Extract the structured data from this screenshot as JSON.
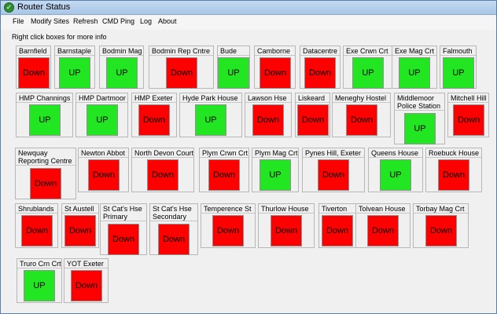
{
  "window": {
    "title": "Router Status",
    "icon": "router-status-app-icon"
  },
  "menu": [
    "File",
    "Modify Sites",
    "Refresh",
    "CMD Ping",
    "Log",
    "About"
  ],
  "hint": "Right click boxes for more info",
  "status_labels": {
    "up": "UP",
    "down": "Down"
  },
  "colors": {
    "up": "#22e622",
    "down": "#ff0000"
  },
  "sites": [
    {
      "name": "Barnfield",
      "status": "down"
    },
    {
      "name": "Barnstaple",
      "status": "up"
    },
    {
      "name": "Bodmin Mag",
      "status": "up"
    },
    {
      "name": "Bodmin Rep Cntre",
      "status": "down"
    },
    {
      "name": "Bude",
      "status": "up"
    },
    {
      "name": "Camborne",
      "status": "down"
    },
    {
      "name": "Datacentre",
      "status": "down"
    },
    {
      "name": "Exe Crwn Crt",
      "status": "up"
    },
    {
      "name": "Exe Mag Crt",
      "status": "up"
    },
    {
      "name": "Falmouth",
      "status": "up"
    },
    {
      "name": "HMP Channings",
      "status": "up"
    },
    {
      "name": "HMP Dartmoor",
      "status": "up"
    },
    {
      "name": "HMP Exeter",
      "status": "down"
    },
    {
      "name": "Hyde Park House",
      "status": "up"
    },
    {
      "name": "Lawson Hse",
      "status": "down"
    },
    {
      "name": "Liskeard",
      "status": "down"
    },
    {
      "name": "Meneghy Hostel",
      "status": "down"
    },
    {
      "name": "Middlemoor Police Station",
      "status": "up"
    },
    {
      "name": "Mitchell Hill",
      "status": "down"
    },
    {
      "name": "Newquay Reporting Centre",
      "status": "down"
    },
    {
      "name": "Newton Abbot",
      "status": "down"
    },
    {
      "name": "North Devon Court",
      "status": "down"
    },
    {
      "name": "Plym Crwn Crt",
      "status": "down"
    },
    {
      "name": "Plym Mag Crt",
      "status": "up"
    },
    {
      "name": "Pynes Hill, Exeter",
      "status": "down"
    },
    {
      "name": "Queens House",
      "status": "up"
    },
    {
      "name": "Roebuck House",
      "status": "down"
    },
    {
      "name": "Shrublands",
      "status": "down"
    },
    {
      "name": "St Austell",
      "status": "down"
    },
    {
      "name": "St Cat's Hse Primary",
      "status": "down"
    },
    {
      "name": "St Cat's Hse Secondary",
      "status": "down"
    },
    {
      "name": "Temperence St",
      "status": "down"
    },
    {
      "name": "Thurlow House",
      "status": "down"
    },
    {
      "name": "Tiverton",
      "status": "down"
    },
    {
      "name": "Tolvean House",
      "status": "down"
    },
    {
      "name": "Torbay Mag Crt",
      "status": "down"
    },
    {
      "name": "Truro Crn Crt",
      "status": "up"
    },
    {
      "name": "YOT Exeter",
      "status": "down"
    }
  ]
}
